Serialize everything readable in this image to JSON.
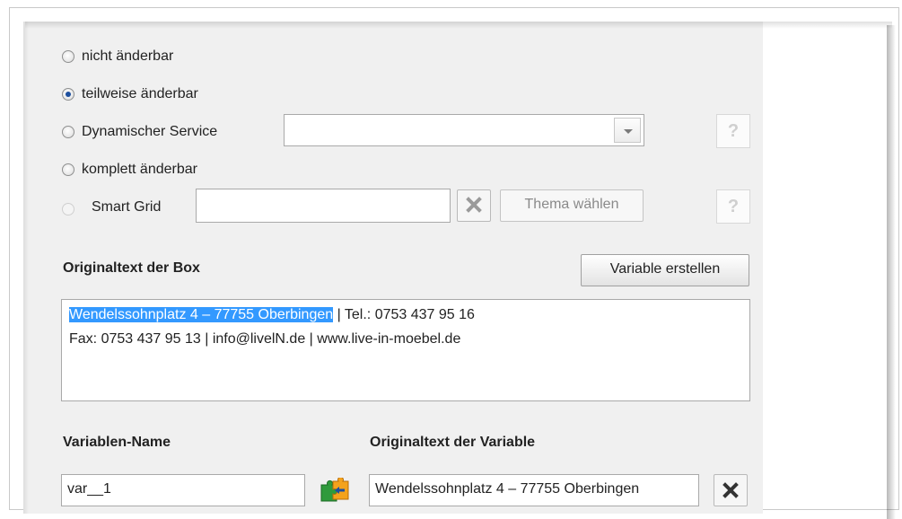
{
  "options": [
    {
      "label": "nicht änderbar",
      "checked": false,
      "disabled": false
    },
    {
      "label": "teilweise änderbar",
      "checked": true,
      "disabled": false
    },
    {
      "label": "Dynamischer Service",
      "checked": false,
      "disabled": false
    },
    {
      "label": "komplett änderbar",
      "checked": false,
      "disabled": false
    },
    {
      "label": "Smart Grid",
      "checked": false,
      "disabled": true
    }
  ],
  "dynamic_service_select": {
    "value": ""
  },
  "smart_grid": {
    "input_value": "",
    "theme_button": "Thema wählen"
  },
  "help_label": "?",
  "box_section": {
    "heading": "Originaltext der Box",
    "create_variable_button": "Variable erstellen",
    "text_line1_selected": "Wendelssohnplatz 4 – 77755 Oberbingen",
    "text_line1_rest": " | Tel.: 0753 437 95 16",
    "text_line2": "Fax: 0753 437 95 13 | info@livelN.de | www.live-in-moebel.de"
  },
  "variable": {
    "name_label": "Variablen-Name",
    "text_label": "Originaltext der Variable",
    "name_value": "var__1",
    "text_value": "Wendelssohnplatz 4 – 77755 Oberbingen"
  },
  "colors": {
    "selection": "#3399ff",
    "radio_dot": "#1d4f9e",
    "panel": "#f0f0f0"
  }
}
